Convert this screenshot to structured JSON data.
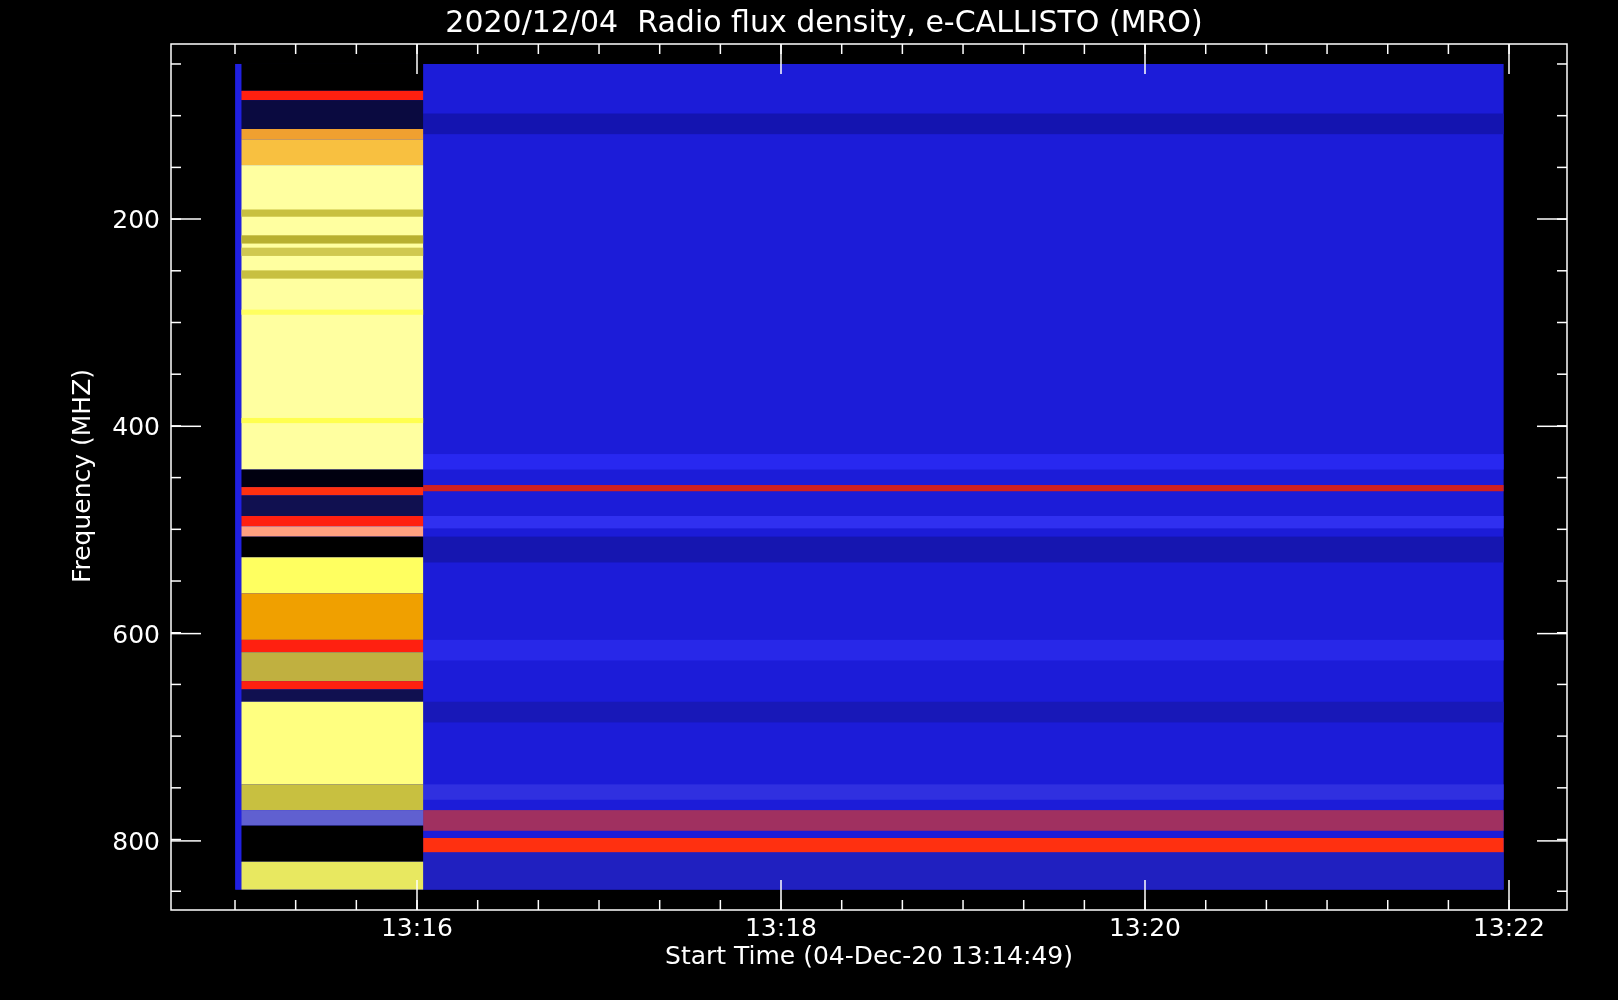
{
  "title": "2020/12/04  Radio flux density, e-CALLISTO (MRO)",
  "y_axis": {
    "label": "Frequency (MHZ)",
    "ticks": [
      "200",
      "400",
      "600",
      "800"
    ]
  },
  "x_axis": {
    "label": "Start Time (04-Dec-20 13:14:49)",
    "ticks": [
      "13:16",
      "13:18",
      "13:20",
      "13:22"
    ]
  }
}
